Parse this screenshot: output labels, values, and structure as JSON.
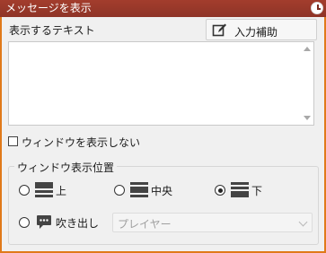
{
  "window": {
    "title": "メッセージを表示",
    "accent": "#e07a1a",
    "titlebar_color": "#8e3427",
    "title_icon": "clock-icon"
  },
  "text_section": {
    "label": "表示するテキスト",
    "assist_button": "入力補助",
    "assist_icon": "edit-icon",
    "value": ""
  },
  "hide_window": {
    "label": "ウィンドウを表示しない",
    "checked": false
  },
  "position_group": {
    "title": "ウィンドウ表示位置",
    "options": [
      {
        "label": "上",
        "icon": "window-top-icon",
        "selected": false
      },
      {
        "label": "中央",
        "icon": "window-middle-icon",
        "selected": false
      },
      {
        "label": "下",
        "icon": "window-bottom-icon",
        "selected": true
      },
      {
        "label": "吹き出し",
        "icon": "speech-bubble-icon",
        "selected": false
      }
    ],
    "speaker_select": {
      "value": "プレイヤー",
      "disabled": true
    }
  }
}
